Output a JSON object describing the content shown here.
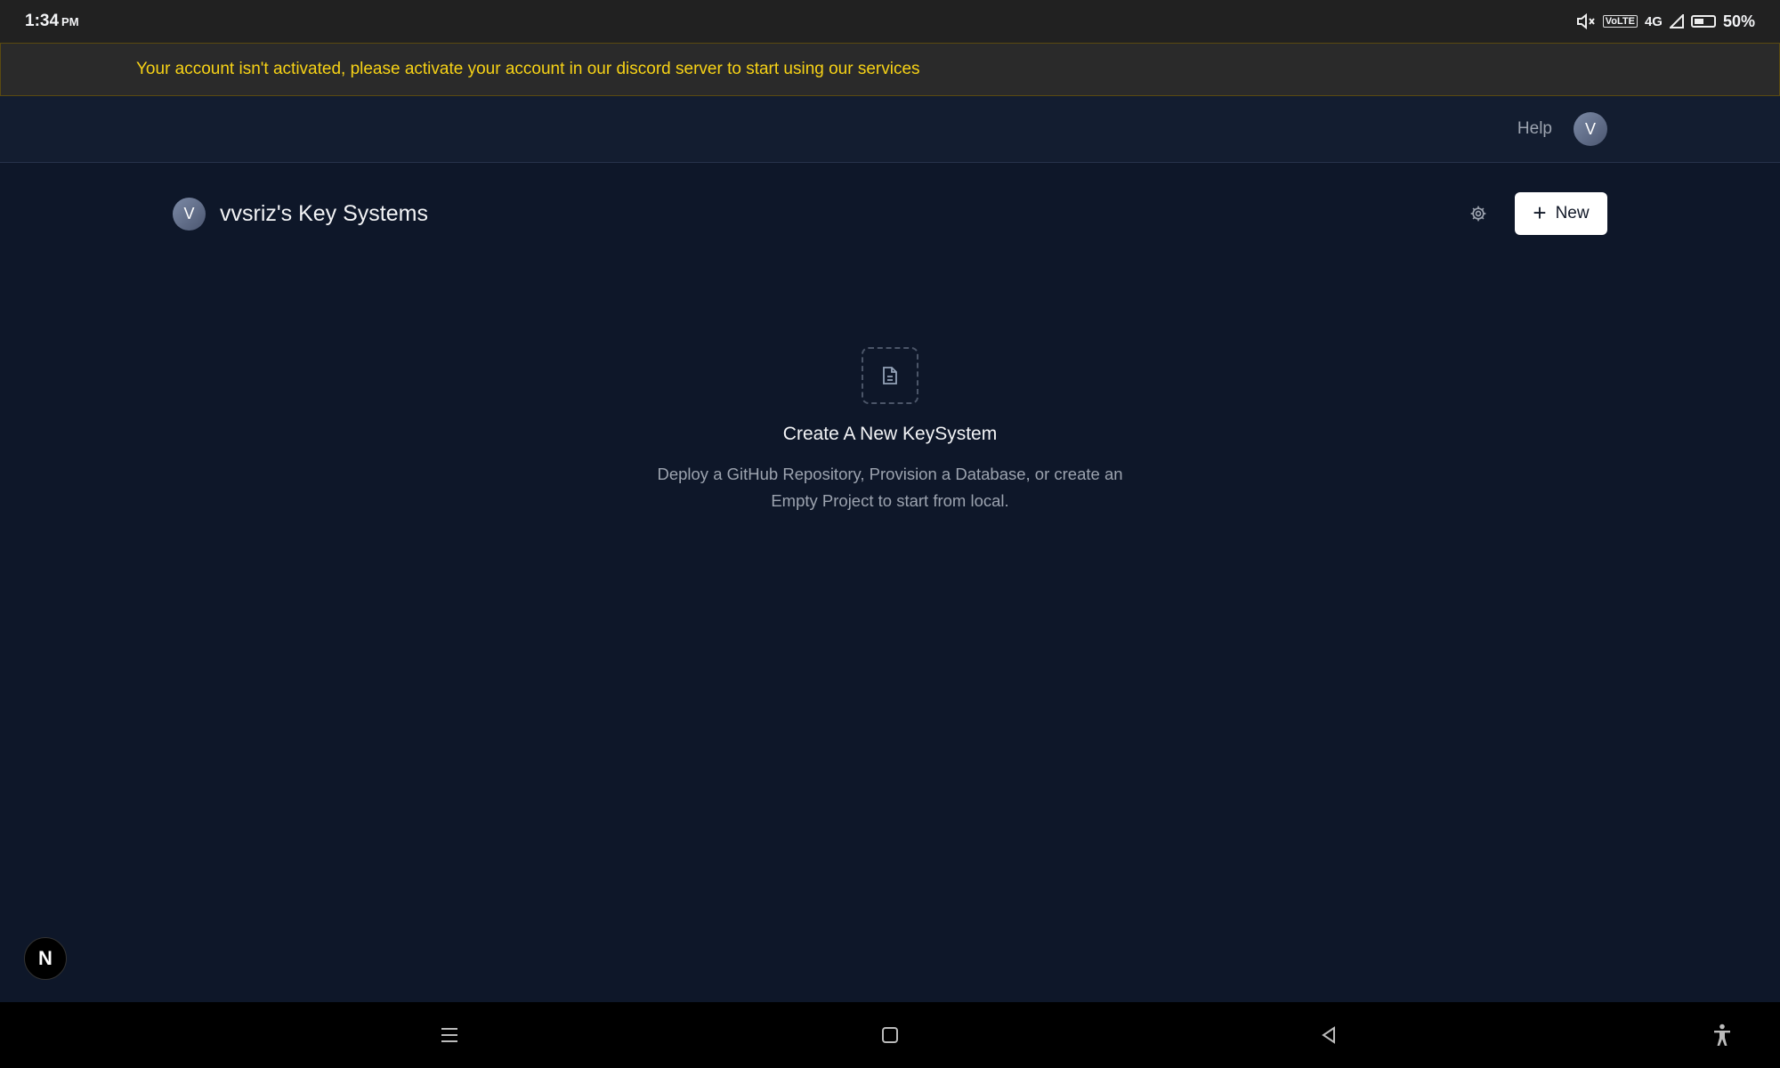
{
  "status_bar": {
    "time": "1:34",
    "ampm": "PM",
    "network_label": "4G",
    "volte_label": "VoLTE",
    "battery": "50%"
  },
  "banner": {
    "text": "Your account isn't activated, please activate your account in our discord server to start using our services",
    "color": "#f7d216"
  },
  "topnav": {
    "help_label": "Help",
    "avatar_initial": "V"
  },
  "workspace": {
    "avatar_initial": "V",
    "title": "vvsriz's Key Systems",
    "new_label": "New",
    "new_icon": "plus-icon",
    "settings_icon": "gear-icon"
  },
  "empty_state": {
    "icon": "document-icon",
    "title": "Create A New KeySystem",
    "description": "Deploy a GitHub Repository, Provision a Database, or create an Empty Project to start from local."
  },
  "fab": {
    "label": "N"
  },
  "system_nav": {
    "buttons": [
      "menu-icon",
      "home-icon",
      "back-icon",
      "accessibility-icon"
    ]
  },
  "colors": {
    "background": "#0e1729",
    "topnav": "#131d30",
    "banner_bg": "#2a2a2a",
    "primary_button": "#ffffff"
  }
}
